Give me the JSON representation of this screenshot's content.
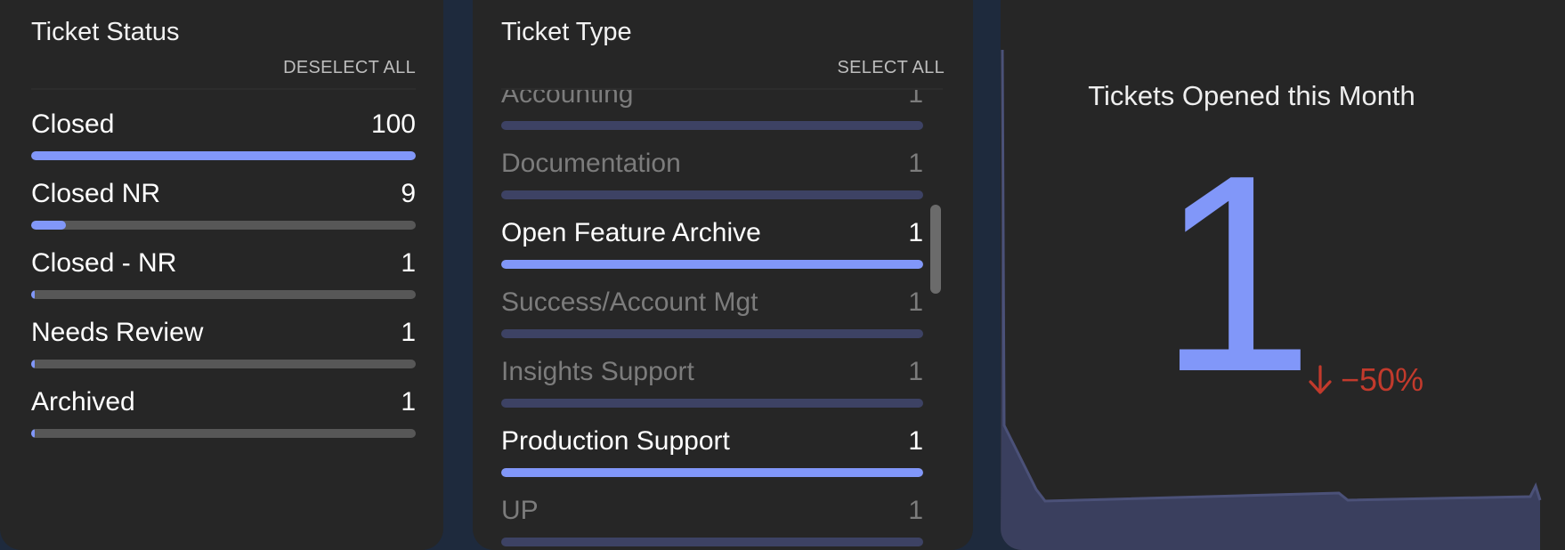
{
  "ticket_status": {
    "title": "Ticket Status",
    "action_label": "DESELECT ALL",
    "items": [
      {
        "label": "Closed",
        "count": "100",
        "fraction": 1.0
      },
      {
        "label": "Closed NR",
        "count": "9",
        "fraction": 0.09
      },
      {
        "label": "Closed - NR",
        "count": "1",
        "fraction": 0.01
      },
      {
        "label": "Needs Review",
        "count": "1",
        "fraction": 0.01
      },
      {
        "label": "Archived",
        "count": "1",
        "fraction": 0.01
      }
    ]
  },
  "ticket_type": {
    "title": "Ticket Type",
    "action_label": "SELECT ALL",
    "items": [
      {
        "label": "Accounting",
        "count": "1",
        "selected": false
      },
      {
        "label": "Documentation",
        "count": "1",
        "selected": false
      },
      {
        "label": "Open Feature Archive",
        "count": "1",
        "selected": true
      },
      {
        "label": "Success/Account Mgt",
        "count": "1",
        "selected": false
      },
      {
        "label": "Insights Support",
        "count": "1",
        "selected": false
      },
      {
        "label": "Production Support",
        "count": "1",
        "selected": true
      },
      {
        "label": "UP",
        "count": "1",
        "selected": false
      }
    ]
  },
  "kpi": {
    "title": "Tickets Opened this Month",
    "value": "1",
    "delta": "−50%",
    "delta_direction": "down",
    "delta_icon": "down-arrow-icon",
    "value_color": "#8197f9",
    "delta_color": "#c23a2c"
  },
  "colors": {
    "background": "#1e2a3d",
    "card": "#262626",
    "bar_fill": "#8197f9",
    "bar_track": "#575757",
    "bar_track_unselected": "#3d4264"
  }
}
